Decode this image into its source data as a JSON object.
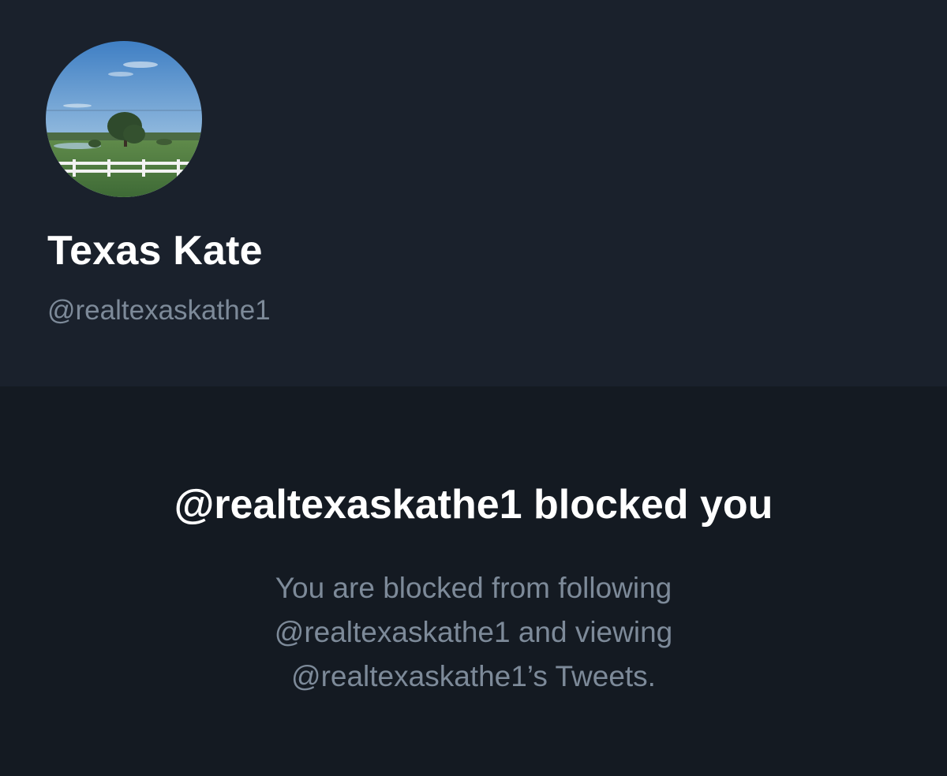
{
  "profile": {
    "display_name": "Texas Kate",
    "handle": "@realtexaskathe1",
    "avatar": "landscape-photo"
  },
  "blocked_notice": {
    "title": "@realtexaskathe1 blocked you",
    "message_lines": [
      "You are blocked from following",
      "@realtexaskathe1 and viewing",
      "@realtexaskathe1’s Tweets."
    ]
  },
  "colors": {
    "header_background": "#1a212c",
    "page_background": "#141a22",
    "primary_text": "#ffffff",
    "secondary_text": "#7d8a99"
  }
}
